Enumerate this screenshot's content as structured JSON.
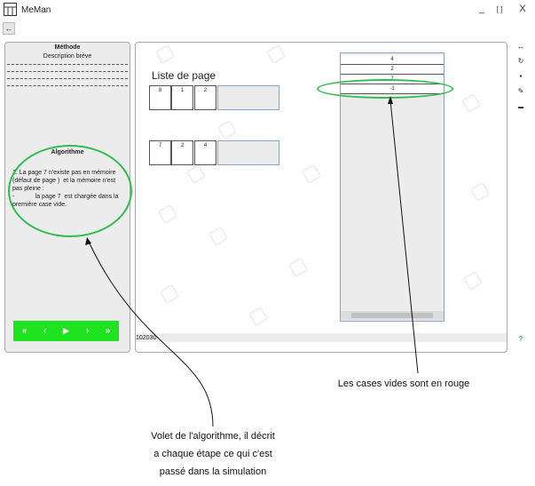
{
  "window": {
    "title": "MeMan",
    "minimize": "_",
    "maximize": "[ ]",
    "close": "X"
  },
  "back_button": "←",
  "left_panel": {
    "methode_title": "Méthode",
    "methode_desc": "Description brève",
    "algo_title": "Algorithme",
    "algo_text": "1. La page 7 n'existe pas en mémoire (défaut de page )  et la mémoire n'est pas pleine :\n-            la page 7  est chargée dans la première case vide."
  },
  "controls": {
    "first": "«",
    "prev": "‹",
    "play": "▶",
    "next": "›",
    "last": "»"
  },
  "main": {
    "liste_title": "Liste de page",
    "row1": [
      "8",
      "1",
      "2"
    ],
    "row2": [
      "7",
      "2",
      "4"
    ],
    "memory": [
      "4",
      "2",
      "7",
      "-1"
    ],
    "status": "102030"
  },
  "toolbar": {
    "expand": "↔",
    "refresh": "↻",
    "save": "▪",
    "edit": "✎",
    "folder": "▬",
    "help": "?"
  },
  "annotations": {
    "memory_note": "Les cases vides sont en rouge",
    "algo_note_1": "Volet de l'algorithme,  il décrit",
    "algo_note_2": "a chaque étape ce qui c'est",
    "algo_note_3": "passé dans la simulation"
  },
  "colors": {
    "highlight": "#2ebd4f",
    "controls_bg": "#1ee31e",
    "help": "#2ebd4f"
  }
}
